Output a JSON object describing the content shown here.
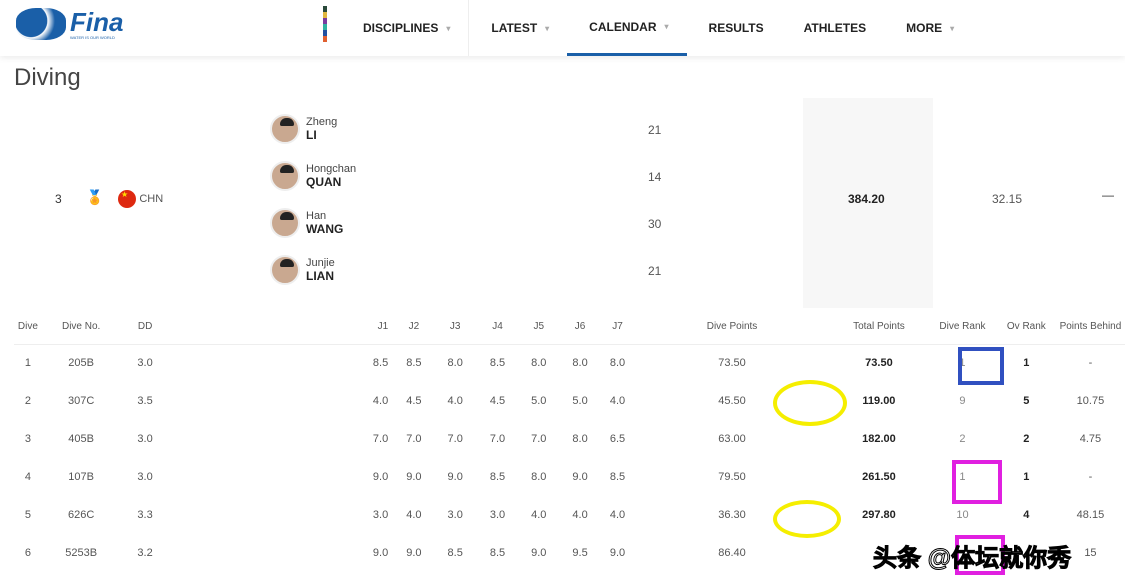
{
  "nav": {
    "logo_text": "Fina",
    "logo_tagline": "WATER IS OUR WORLD",
    "items": [
      {
        "label": "DISCIPLINES",
        "caret": true
      },
      {
        "label": "LATEST",
        "caret": true
      },
      {
        "label": "CALENDAR",
        "caret": true,
        "active": true
      },
      {
        "label": "RESULTS",
        "caret": false
      },
      {
        "label": "ATHLETES",
        "caret": false
      },
      {
        "label": "MORE",
        "caret": true
      }
    ]
  },
  "page_title": "Diving",
  "team": {
    "rank": "3",
    "medal": "bronze-medal-icon",
    "country": "CHN",
    "total": "384.20",
    "behind": "32.15",
    "toggle": "—",
    "athletes": [
      {
        "first": "Zheng",
        "last": "LI",
        "age": "21"
      },
      {
        "first": "Hongchan",
        "last": "QUAN",
        "age": "14"
      },
      {
        "first": "Han",
        "last": "WANG",
        "age": "30"
      },
      {
        "first": "Junjie",
        "last": "LIAN",
        "age": "21"
      }
    ]
  },
  "table": {
    "headers": [
      "Dive",
      "Dive No.",
      "DD",
      "J1",
      "J2",
      "J3",
      "J4",
      "J5",
      "J6",
      "J7",
      "Dive Points",
      "Total Points",
      "Dive Rank",
      "Ov Rank",
      "Points Behind"
    ],
    "rows": [
      [
        "1",
        "205B",
        "3.0",
        "8.5",
        "8.5",
        "8.0",
        "8.5",
        "8.0",
        "8.0",
        "8.0",
        "73.50",
        "73.50",
        "1",
        "1",
        "-"
      ],
      [
        "2",
        "307C",
        "3.5",
        "4.0",
        "4.5",
        "4.0",
        "4.5",
        "5.0",
        "5.0",
        "4.0",
        "45.50",
        "119.00",
        "9",
        "5",
        "10.75"
      ],
      [
        "3",
        "405B",
        "3.0",
        "7.0",
        "7.0",
        "7.0",
        "7.0",
        "7.0",
        "8.0",
        "6.5",
        "63.00",
        "182.00",
        "2",
        "2",
        "4.75"
      ],
      [
        "4",
        "107B",
        "3.0",
        "9.0",
        "9.0",
        "9.0",
        "8.5",
        "8.0",
        "9.0",
        "8.5",
        "79.50",
        "261.50",
        "1",
        "1",
        "-"
      ],
      [
        "5",
        "626C",
        "3.3",
        "3.0",
        "4.0",
        "3.0",
        "3.0",
        "4.0",
        "4.0",
        "4.0",
        "36.30",
        "297.80",
        "10",
        "4",
        "48.15"
      ],
      [
        "6",
        "5253B",
        "3.2",
        "9.0",
        "9.0",
        "8.5",
        "8.5",
        "9.0",
        "9.5",
        "9.0",
        "86.40",
        "",
        "",
        "",
        "15"
      ]
    ]
  },
  "annotations": {
    "ring_color": "#f5ee00",
    "box_blue": "#3050c0",
    "box_magenta": "#e020e0"
  },
  "watermark": "头条 @体坛就你秀"
}
